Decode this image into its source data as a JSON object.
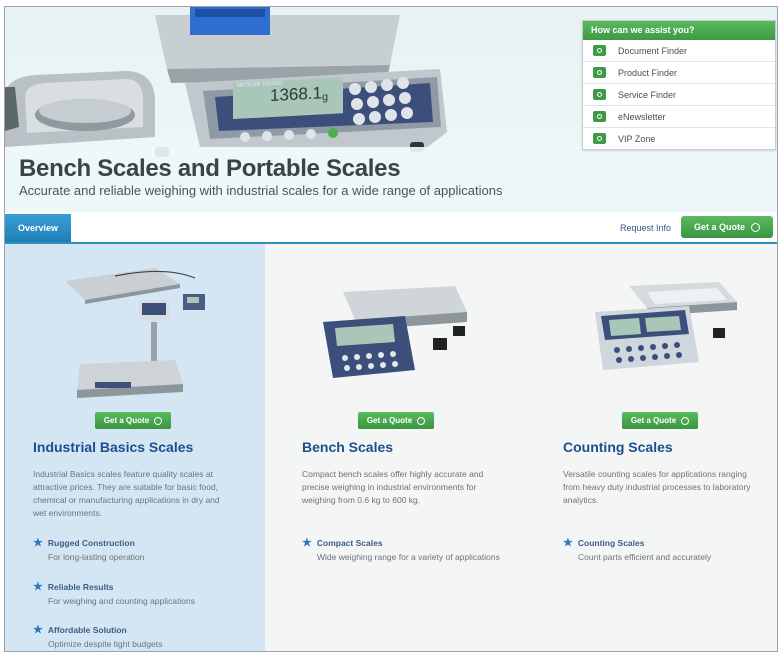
{
  "hero": {
    "title": "Bench Scales and Portable Scales",
    "subtitle": "Accurate and reliable weighing with industrial scales for a wide range of applications",
    "display_reading": "1368.1",
    "display_unit": "g",
    "brand": "METTLER TOLEDO"
  },
  "assist": {
    "heading": "How can we assist you?",
    "items": [
      {
        "label": "Document Finder"
      },
      {
        "label": "Product Finder"
      },
      {
        "label": "Service Finder"
      },
      {
        "label": "eNewsletter"
      },
      {
        "label": "VIP Zone"
      }
    ]
  },
  "nav": {
    "tab_overview": "Overview",
    "request_info": "Request Info",
    "quote_label": "Get a Quote"
  },
  "columns": [
    {
      "quote_label": "Get a Quote",
      "title": "Industrial Basics Scales",
      "description": "Industrial Basics scales feature quality scales at attractive prices. They are suitable for basic food, chemical or manufacturing applications in dry and wet environments.",
      "features": [
        {
          "title": "Rugged Construction",
          "text": "For long-lasting operation"
        },
        {
          "title": "Reliable Results",
          "text": "For weighing and counting applications"
        },
        {
          "title": "Affordable Solution",
          "text": "Optimize despite tight budgets"
        }
      ]
    },
    {
      "quote_label": "Get a Quote",
      "title": "Bench Scales",
      "description": "Compact bench scales offer highly accurate and precise weighing in industrial environments for weighing from 0.6 kg to 600 kg.",
      "features": [
        {
          "title": "Compact Scales",
          "text": "Wide weighing range for a variety of applications"
        }
      ]
    },
    {
      "quote_label": "Get a Quote",
      "title": "Counting Scales",
      "description": "Versatile counting scales for applications ranging from heavy duty industrial processes to laboratory analytics.",
      "features": [
        {
          "title": "Counting Scales",
          "text": "Count parts efficient and accurately"
        }
      ]
    }
  ],
  "colors": {
    "accent_green": "#3e9a44",
    "accent_blue": "#2f8ec2",
    "title_blue": "#1c4f8c",
    "sidebar_blue": "#d4e6f3"
  }
}
